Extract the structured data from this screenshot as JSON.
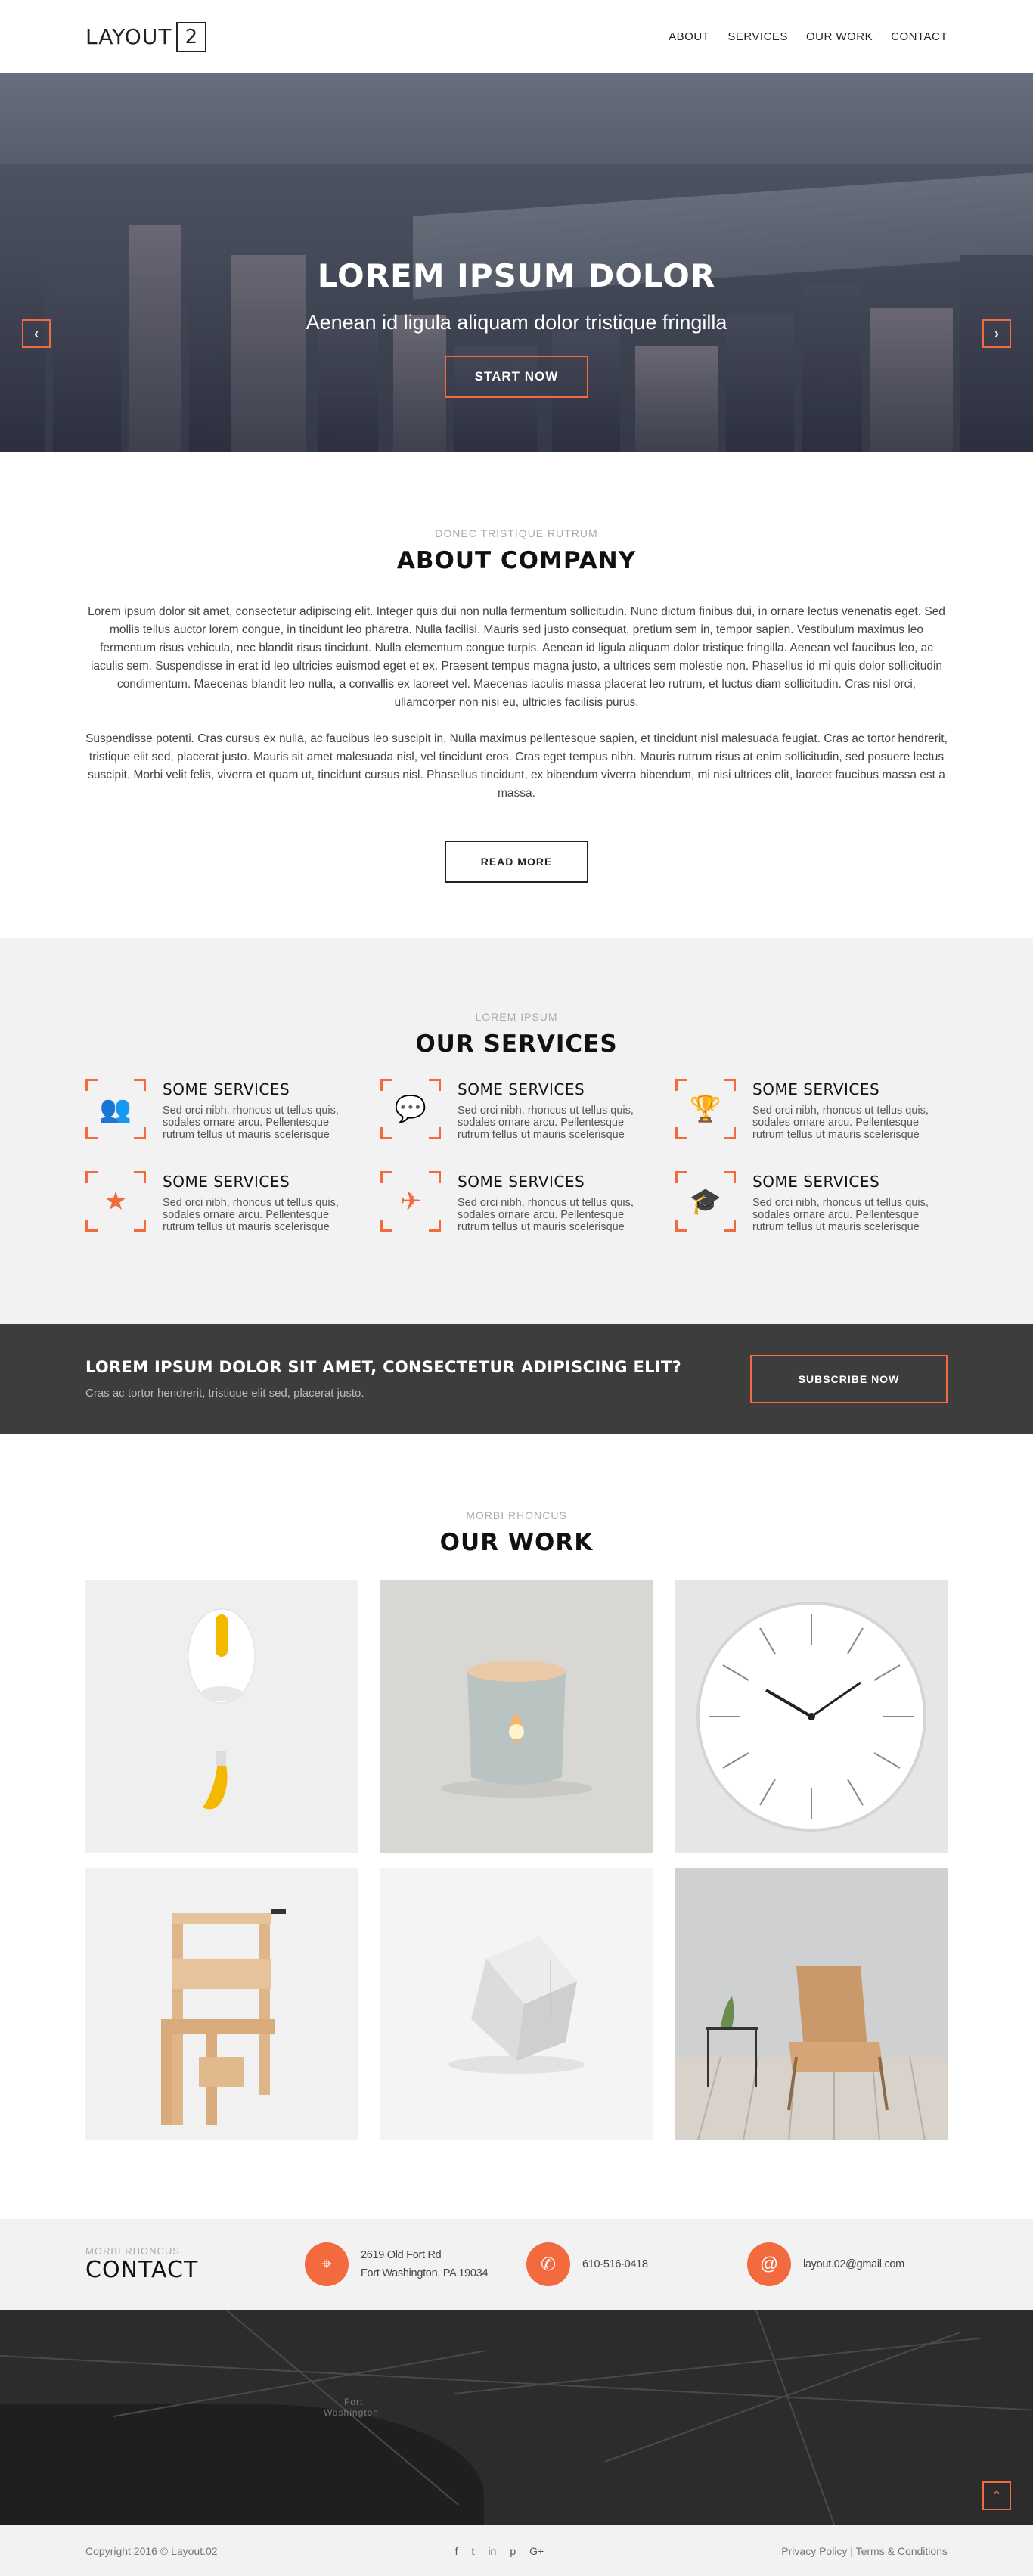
{
  "header": {
    "logo_text": "LAYOUT",
    "logo_num": "2",
    "nav": [
      "ABOUT",
      "SERVICES",
      "OUR WORK",
      "CONTACT"
    ]
  },
  "hero": {
    "title": "LOREM IPSUM DOLOR",
    "subtitle": "Aenean id ligula aliquam dolor tristique fringilla",
    "button": "START NOW",
    "prev_icon": "chevron-left-icon",
    "next_icon": "chevron-right-icon"
  },
  "about": {
    "kicker": "DONEC TRISTIQUE RUTRUM",
    "title": "ABOUT COMPANY",
    "p1": "Lorem ipsum dolor sit amet, consectetur adipiscing elit. Integer quis dui non nulla fermentum sollicitudin. Nunc dictum finibus dui, in ornare lectus venenatis eget. Sed mollis tellus auctor lorem congue, in tincidunt leo pharetra. Nulla facilisi. Mauris sed justo consequat, pretium sem in, tempor sapien. Vestibulum maximus leo fermentum risus vehicula, nec blandit risus tincidunt. Nulla elementum congue turpis. Aenean id ligula aliquam dolor tristique fringilla. Aenean vel faucibus leo, ac iaculis sem. Suspendisse in erat id leo ultricies euismod eget et ex. Praesent tempus magna justo, a ultrices sem molestie non. Phasellus id mi quis dolor sollicitudin condimentum. Maecenas blandit leo nulla, a convallis ex laoreet vel. Maecenas iaculis massa placerat leo rutrum, et luctus diam sollicitudin. Cras nisl orci, ullamcorper non nisi eu, ultricies facilisis purus.",
    "p2": "Suspendisse potenti. Cras cursus ex nulla, ac faucibus leo suscipit in. Nulla maximus pellentesque sapien, et tincidunt nisl malesuada feugiat. Cras ac tortor hendrerit, tristique elit sed, placerat justo. Mauris sit amet malesuada nisl, vel tincidunt eros. Cras eget tempus nibh. Mauris rutrum risus at enim sollicitudin, sed posuere lectus suscipit. Morbi velit felis, viverra et quam ut, tincidunt cursus nisl. Phasellus tincidunt, ex bibendum viverra bibendum, mi nisi ultrices elit, laoreet faucibus massa est a massa.",
    "button": "READ MORE"
  },
  "services": {
    "kicker": "LOREM IPSUM",
    "title": "OUR SERVICES",
    "items": [
      {
        "title": "SOME SERVICES",
        "text": "Sed orci nibh, rhoncus ut tellus quis, sodales ornare arcu. Pellentesque rutrum tellus ut mauris scelerisque",
        "icon": "users-icon",
        "glyph": "👥"
      },
      {
        "title": "SOME SERVICES",
        "text": "Sed orci nibh, rhoncus ut tellus quis, sodales ornare arcu. Pellentesque rutrum tellus ut mauris scelerisque",
        "icon": "chat-icon",
        "glyph": "💬"
      },
      {
        "title": "SOME SERVICES",
        "text": "Sed orci nibh, rhoncus ut tellus quis, sodales ornare arcu. Pellentesque rutrum tellus ut mauris scelerisque",
        "icon": "trophy-icon",
        "glyph": "🏆"
      },
      {
        "title": "SOME SERVICES",
        "text": "Sed orci nibh, rhoncus ut tellus quis, sodales ornare arcu. Pellentesque rutrum tellus ut mauris scelerisque",
        "icon": "star-icon",
        "glyph": "★"
      },
      {
        "title": "SOME SERVICES",
        "text": "Sed orci nibh, rhoncus ut tellus quis, sodales ornare arcu. Pellentesque rutrum tellus ut mauris scelerisque",
        "icon": "plane-icon",
        "glyph": "✈"
      },
      {
        "title": "SOME SERVICES",
        "text": "Sed orci nibh, rhoncus ut tellus quis, sodales ornare arcu. Pellentesque rutrum tellus ut mauris scelerisque",
        "icon": "graduation-cap-icon",
        "glyph": "🎓"
      }
    ]
  },
  "cta": {
    "title": "LOREM IPSUM DOLOR SIT AMET, CONSECTETUR ADIPISCING ELIT?",
    "text": "Cras ac tortor hendrerit, tristique elit sed, placerat justo.",
    "button": "SUBSCRIBE NOW"
  },
  "work": {
    "kicker": "MORBI RHONCUS",
    "title": "OUR WORK",
    "items": [
      "mouse",
      "candle",
      "clock",
      "chair",
      "cube",
      "lounge-chair"
    ]
  },
  "contact": {
    "kicker": "MORBI RHONCUS",
    "title": "CONTACT",
    "address1": "2619 Old Fort Rd",
    "address2": "Fort Washington, PA 19034",
    "phone": "610-516-0418",
    "email": "layout.02@gmail.com"
  },
  "map": {
    "label1": "Fort",
    "label2": "Washington"
  },
  "footer": {
    "copyright": "Copyright 2016 © Layout.02",
    "social": [
      "f",
      "t",
      "in",
      "p",
      "G+"
    ],
    "privacy": "Privacy Policy",
    "sep": "|",
    "terms": "Terms & Conditions"
  },
  "colors": {
    "accent": "#f26a3d",
    "dark": "#3d3d3d",
    "light_bg": "#f2f2f2"
  }
}
